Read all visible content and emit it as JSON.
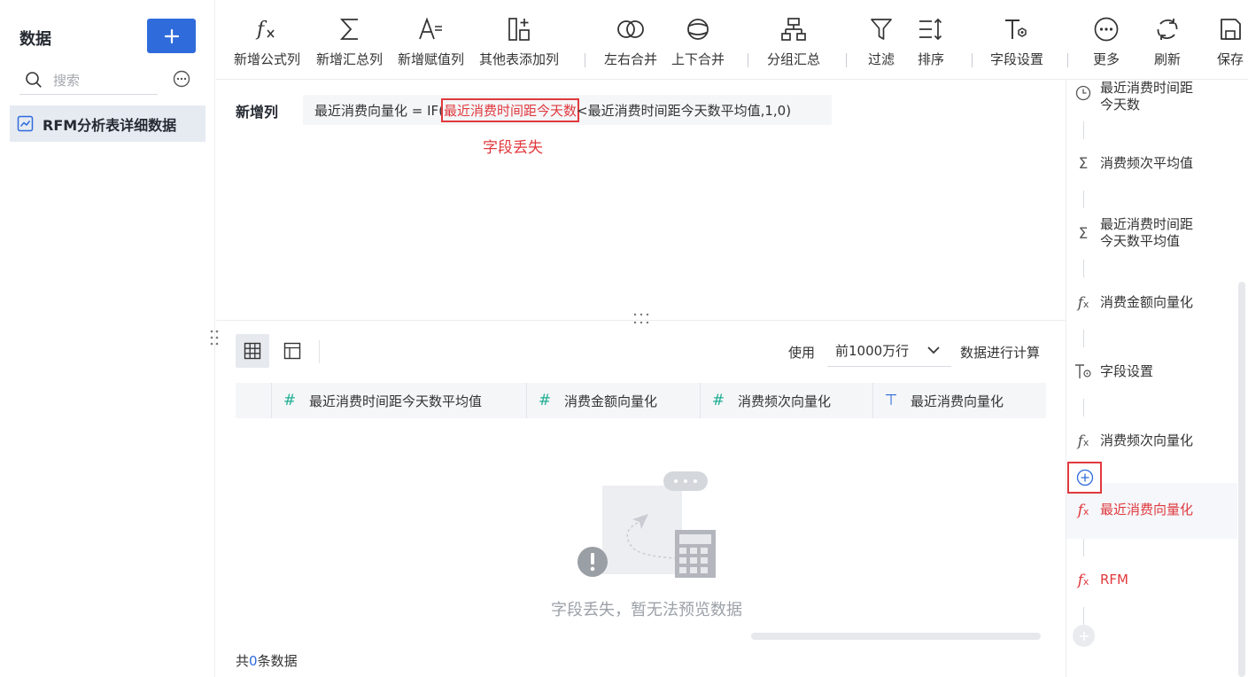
{
  "sidebar": {
    "title": "数据",
    "search_placeholder": "搜索",
    "items": [
      {
        "label": "RFM分析表详细数据"
      }
    ]
  },
  "toolbar": {
    "buttons": [
      {
        "label": "新增公式列",
        "icon": "formula-icon"
      },
      {
        "label": "新增汇总列",
        "icon": "sigma-icon"
      },
      {
        "label": "新增赋值列",
        "icon": "assign-value-icon"
      },
      {
        "label": "其他表添加列",
        "icon": "add-column-icon"
      },
      {
        "label": "左右合并",
        "icon": "merge-horizontal-icon"
      },
      {
        "label": "上下合并",
        "icon": "merge-vertical-icon"
      },
      {
        "label": "分组汇总",
        "icon": "group-summary-icon"
      },
      {
        "label": "过滤",
        "icon": "filter-icon"
      },
      {
        "label": "排序",
        "icon": "sort-icon"
      },
      {
        "label": "字段设置",
        "icon": "field-settings-icon"
      },
      {
        "label": "更多",
        "icon": "more-icon"
      },
      {
        "label": "刷新",
        "icon": "refresh-icon"
      },
      {
        "label": "保存",
        "icon": "save-icon"
      }
    ]
  },
  "formula": {
    "label": "新增列",
    "prefix": "最近消费向量化 = IF(",
    "missing_field": "最近消费时间距今天数",
    "suffix": "<最近消费时间距今天数平均值,1,0)",
    "error_note": "字段丢失"
  },
  "preview": {
    "use_label": "使用",
    "row_limit": "前1000万行",
    "use_suffix": "数据进行计算",
    "columns": [
      {
        "label": "最近消费时间距今天数平均值",
        "type_icon": "number-type-icon"
      },
      {
        "label": "消费金额向量化",
        "type_icon": "number-type-icon"
      },
      {
        "label": "消费频次向量化",
        "type_icon": "number-type-icon"
      },
      {
        "label": "最近消费向量化",
        "type_icon": "text-type-icon"
      }
    ],
    "empty_message": "字段丢失，暂无法预览数据",
    "count_prefix": "共",
    "count_value": "0",
    "count_suffix": "条数据"
  },
  "steps": [
    {
      "label_lines": [
        "最近消费时间距",
        "今天数"
      ],
      "icon": "clock-icon",
      "state": "normal"
    },
    {
      "label_lines": [
        "消费频次平均值"
      ],
      "icon": "sigma-icon",
      "state": "normal"
    },
    {
      "label_lines": [
        "最近消费时间距",
        "今天数平均值"
      ],
      "icon": "sigma-icon",
      "state": "normal"
    },
    {
      "label_lines": [
        "消费金额向量化"
      ],
      "icon": "formula-icon",
      "state": "normal"
    },
    {
      "label_lines": [
        "字段设置"
      ],
      "icon": "field-settings-icon",
      "state": "normal"
    },
    {
      "label_lines": [
        "消费频次向量化"
      ],
      "icon": "formula-icon",
      "state": "normal"
    },
    {
      "label_lines": [
        "最近消费向量化"
      ],
      "icon": "formula-icon",
      "state": "error-active"
    },
    {
      "label_lines": [
        "RFM"
      ],
      "icon": "formula-icon",
      "state": "error"
    }
  ],
  "colors": {
    "primary": "#2f6bdb",
    "error": "#e0393e",
    "number_type": "#1fae93"
  }
}
